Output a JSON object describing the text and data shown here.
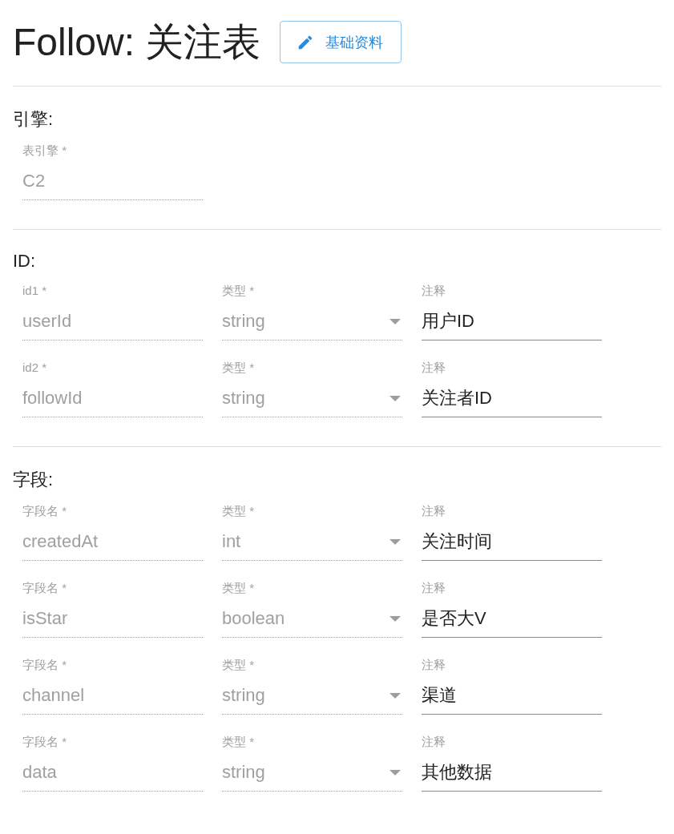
{
  "title": "Follow: 关注表",
  "edit_button": {
    "label": "基础资料"
  },
  "sections": [
    {
      "heading": "引擎:",
      "rows": [
        {
          "fields": [
            {
              "kind": "text",
              "label": "表引擎 *",
              "disabled": true,
              "value": "C2"
            }
          ]
        }
      ]
    },
    {
      "heading": "ID:",
      "rows": [
        {
          "fields": [
            {
              "kind": "text",
              "label": "id1 *",
              "disabled": true,
              "value": "userId"
            },
            {
              "kind": "select",
              "label": "类型 *",
              "disabled": true,
              "value": "string"
            },
            {
              "kind": "text",
              "label": "注释",
              "disabled": false,
              "value": "用户ID"
            }
          ]
        },
        {
          "fields": [
            {
              "kind": "text",
              "label": "id2 *",
              "disabled": true,
              "value": "followId"
            },
            {
              "kind": "select",
              "label": "类型 *",
              "disabled": true,
              "value": "string"
            },
            {
              "kind": "text",
              "label": "注释",
              "disabled": false,
              "value": "关注者ID"
            }
          ]
        }
      ]
    },
    {
      "heading": "字段:",
      "rows": [
        {
          "fields": [
            {
              "kind": "text",
              "label": "字段名 *",
              "disabled": true,
              "value": "createdAt"
            },
            {
              "kind": "select",
              "label": "类型 *",
              "disabled": true,
              "value": "int"
            },
            {
              "kind": "text",
              "label": "注释",
              "disabled": false,
              "value": "关注时间"
            }
          ]
        },
        {
          "fields": [
            {
              "kind": "text",
              "label": "字段名 *",
              "disabled": true,
              "value": "isStar"
            },
            {
              "kind": "select",
              "label": "类型 *",
              "disabled": true,
              "value": "boolean"
            },
            {
              "kind": "text",
              "label": "注释",
              "disabled": false,
              "value": "是否大V"
            }
          ]
        },
        {
          "fields": [
            {
              "kind": "text",
              "label": "字段名 *",
              "disabled": true,
              "value": "channel"
            },
            {
              "kind": "select",
              "label": "类型 *",
              "disabled": true,
              "value": "string"
            },
            {
              "kind": "text",
              "label": "注释",
              "disabled": false,
              "value": "渠道"
            }
          ]
        },
        {
          "fields": [
            {
              "kind": "text",
              "label": "字段名 *",
              "disabled": true,
              "value": "data"
            },
            {
              "kind": "select",
              "label": "类型 *",
              "disabled": true,
              "value": "string"
            },
            {
              "kind": "text",
              "label": "注释",
              "disabled": false,
              "value": "其他数据"
            }
          ]
        }
      ]
    }
  ]
}
